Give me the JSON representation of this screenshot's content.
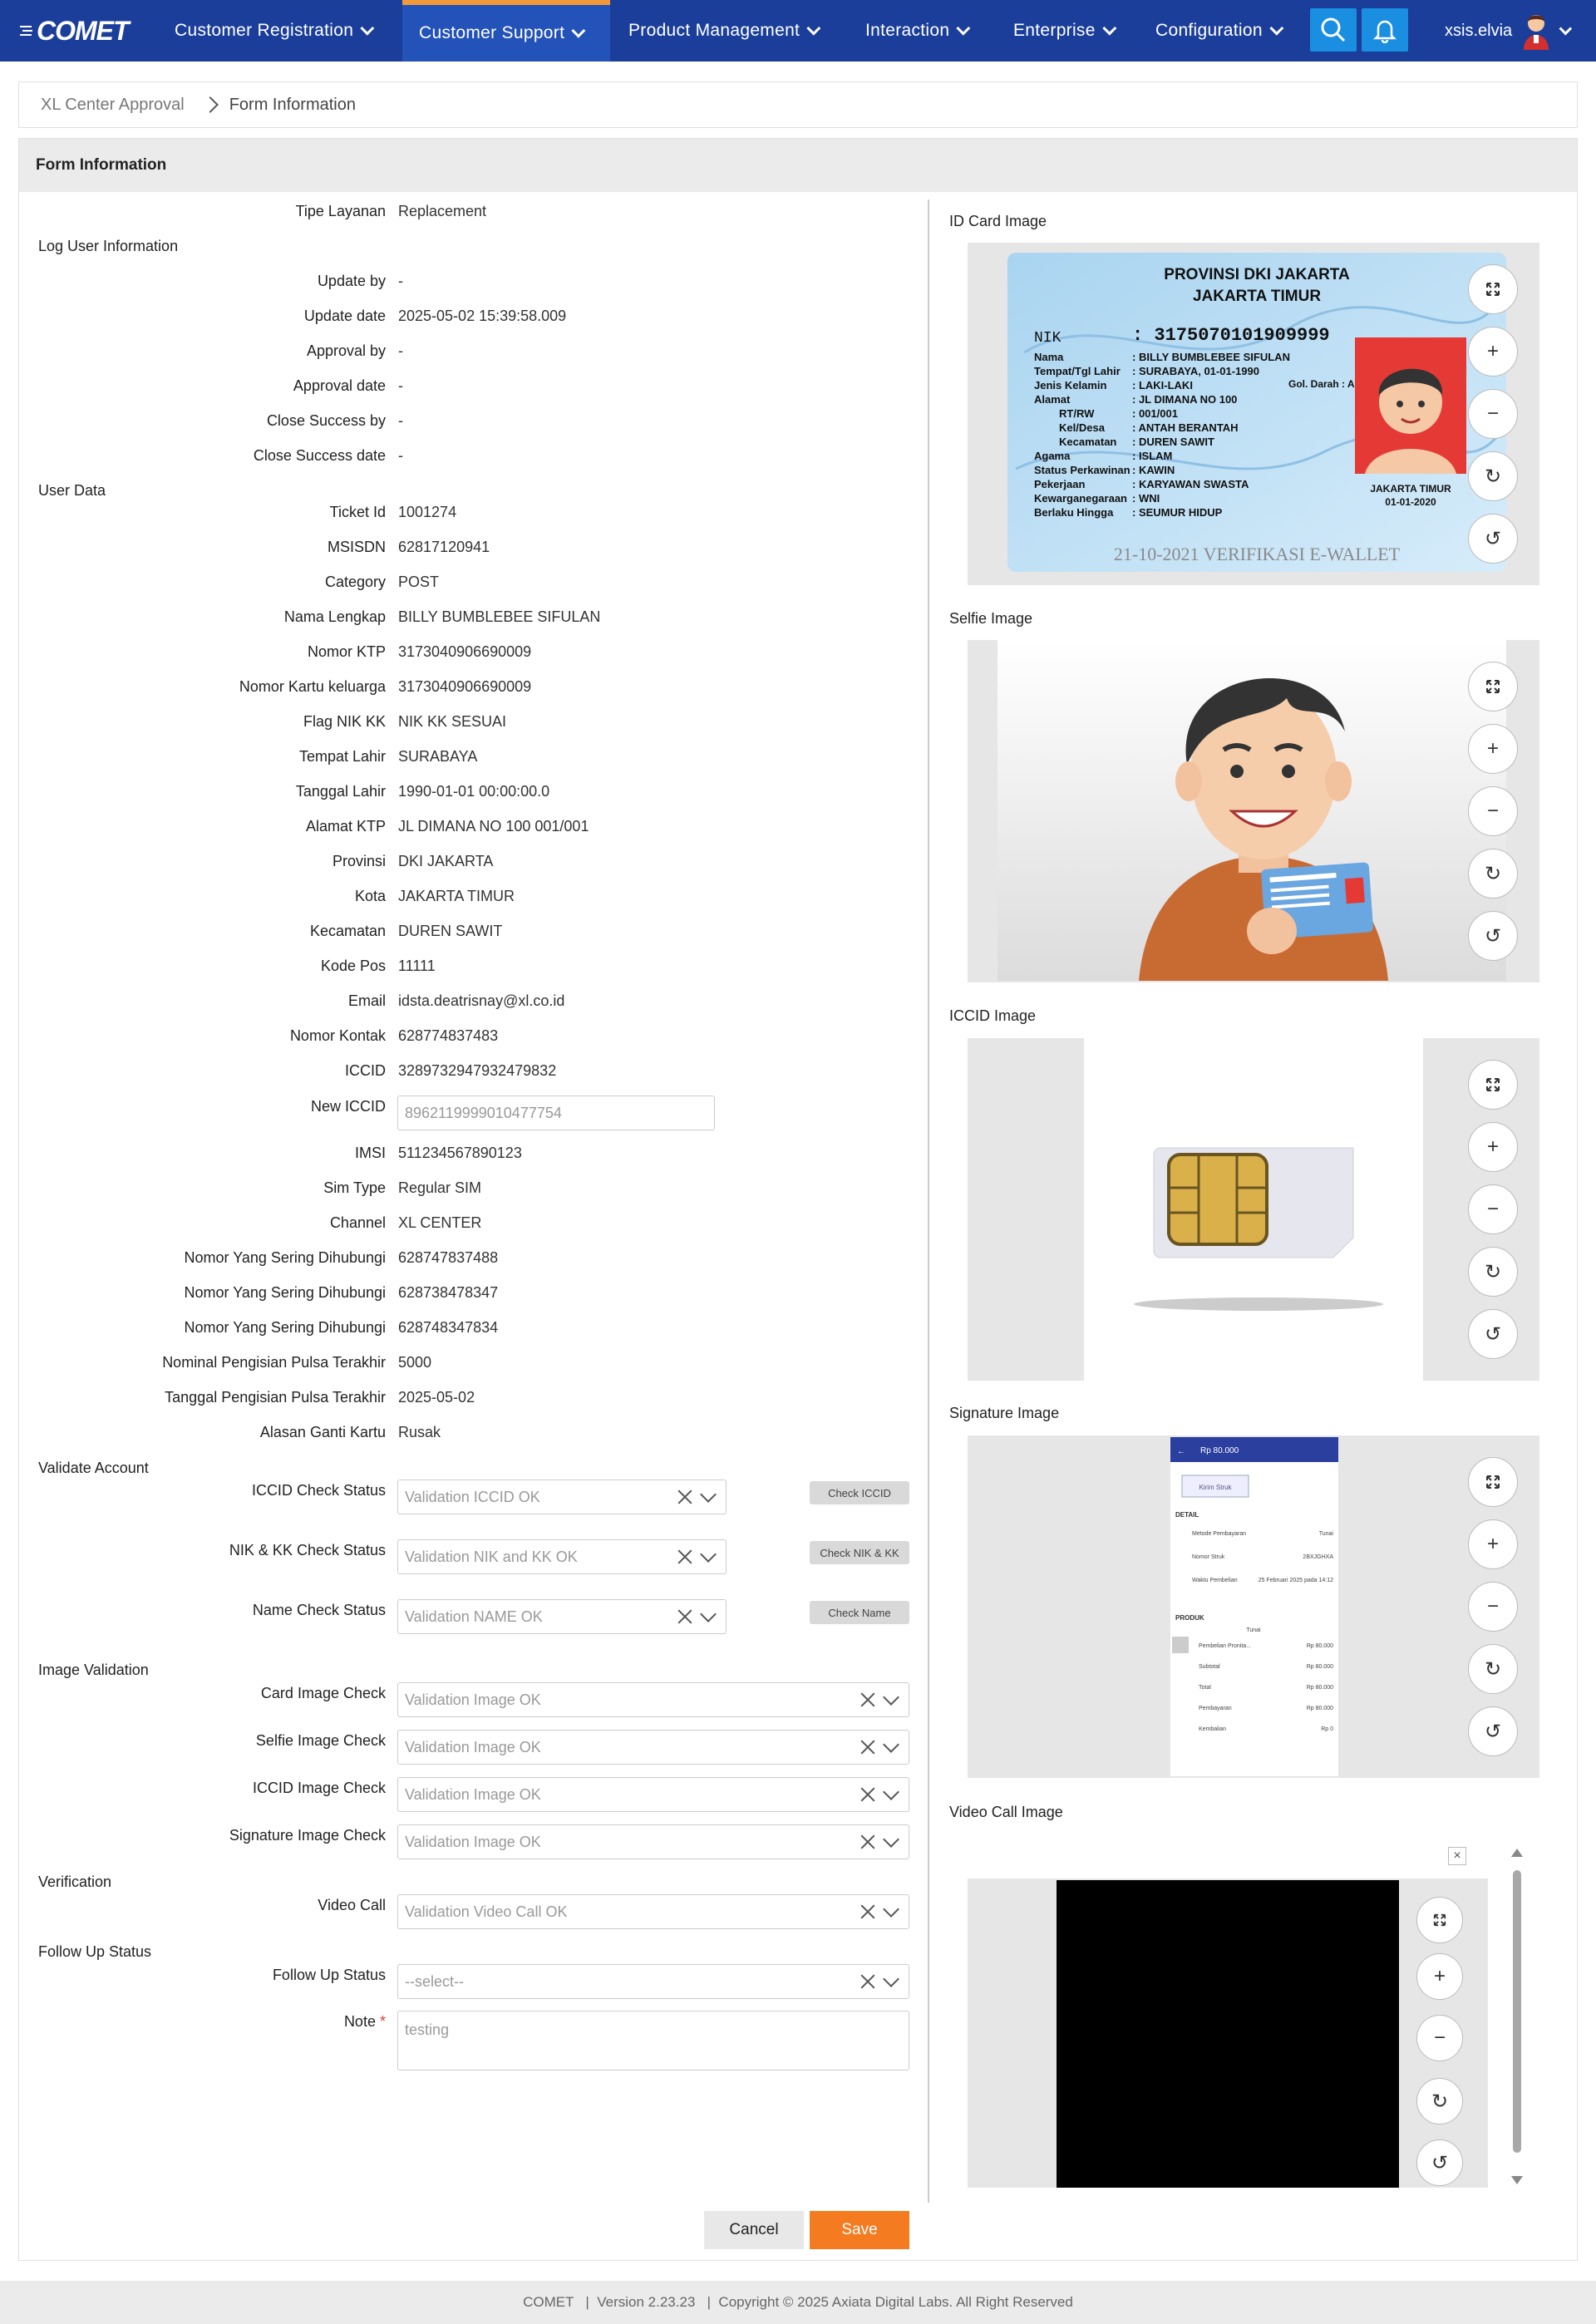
{
  "nav": {
    "logo": "COMET",
    "items": [
      "Customer Registration",
      "Customer Support",
      "Product Management",
      "Interaction",
      "Enterprise",
      "Configuration"
    ],
    "active": "Customer Support",
    "user": "xsis.elvia",
    "accent_color": "#1a3e9a",
    "active_indicator_color": "#f29a3a"
  },
  "breadcrumb": [
    "XL Center Approval",
    "Form Information"
  ],
  "form": {
    "title": "Form Information",
    "tipe_layanan_label": "Tipe Layanan",
    "tipe_layanan_value": "Replacement",
    "sections": {
      "log": "Log User Information",
      "user": "User Data",
      "validate": "Validate Account",
      "image_validation": "Image Validation",
      "verification": "Verification",
      "follow_up": "Follow Up Status"
    },
    "log_fields": [
      {
        "label": "Update by",
        "value": "-"
      },
      {
        "label": "Update date",
        "value": "2025-05-02 15:39:58.009"
      },
      {
        "label": "Approval by",
        "value": "-"
      },
      {
        "label": "Approval date",
        "value": "-"
      },
      {
        "label": "Close Success by",
        "value": "-"
      },
      {
        "label": "Close Success date",
        "value": "-"
      }
    ],
    "user_fields": [
      {
        "label": "Ticket Id",
        "value": "1001274"
      },
      {
        "label": "MSISDN",
        "value": "62817120941"
      },
      {
        "label": "Category",
        "value": "POST"
      },
      {
        "label": "Nama Lengkap",
        "value": "BILLY BUMBLEBEE SIFULAN"
      },
      {
        "label": "Nomor KTP",
        "value": "3173040906690009"
      },
      {
        "label": "Nomor Kartu keluarga",
        "value": "3173040906690009"
      },
      {
        "label": "Flag NIK KK",
        "value": "NIK KK SESUAI"
      },
      {
        "label": "Tempat Lahir",
        "value": "SURABAYA"
      },
      {
        "label": "Tanggal Lahir",
        "value": "1990-01-01 00:00:00.0"
      },
      {
        "label": "Alamat KTP",
        "value": "JL DIMANA NO 100 001/001"
      },
      {
        "label": "Provinsi",
        "value": "DKI JAKARTA"
      },
      {
        "label": "Kota",
        "value": "JAKARTA TIMUR"
      },
      {
        "label": "Kecamatan",
        "value": "DUREN SAWIT"
      },
      {
        "label": "Kode Pos",
        "value": "11111"
      },
      {
        "label": "Email",
        "value": "idsta.deatrisnay@xl.co.id"
      },
      {
        "label": "Nomor Kontak",
        "value": "628774837483"
      },
      {
        "label": "ICCID",
        "value": "3289732947932479832"
      }
    ],
    "new_iccid_label": "New ICCID",
    "new_iccid_value": "8962119999010477754",
    "user_fields2": [
      {
        "label": "IMSI",
        "value": "511234567890123"
      },
      {
        "label": "Sim Type",
        "value": "Regular SIM"
      },
      {
        "label": "Channel",
        "value": "XL CENTER"
      },
      {
        "label": "Nomor Yang Sering Dihubungi",
        "value": "628747837488"
      },
      {
        "label": "Nomor Yang Sering Dihubungi",
        "value": "628738478347"
      },
      {
        "label": "Nomor Yang Sering Dihubungi",
        "value": "628748347834"
      },
      {
        "label": "Nominal Pengisian Pulsa Terakhir",
        "value": "5000"
      },
      {
        "label": "Tanggal Pengisian Pulsa Terakhir",
        "value": "2025-05-02"
      },
      {
        "label": "Alasan Ganti Kartu",
        "value": "Rusak"
      }
    ],
    "validate_fields": [
      {
        "label": "ICCID Check Status",
        "value": "Validation ICCID OK",
        "button": "Check ICCID"
      },
      {
        "label": "NIK & KK Check Status",
        "value": "Validation NIK and KK OK",
        "button": "Check NIK & KK"
      },
      {
        "label": "Name Check Status",
        "value": "Validation NAME OK",
        "button": "Check Name"
      }
    ],
    "image_fields": [
      {
        "label": "Card Image Check",
        "value": "Validation Image OK"
      },
      {
        "label": "Selfie Image Check",
        "value": "Validation Image OK"
      },
      {
        "label": "ICCID Image Check",
        "value": "Validation Image OK"
      },
      {
        "label": "Signature Image Check",
        "value": "Validation Image OK"
      }
    ],
    "video_call_label": "Video Call",
    "video_call_value": "Validation Video Call OK",
    "follow_up_label": "Follow Up Status",
    "follow_up_value": "--select--",
    "note_label": "Note",
    "note_required": "*",
    "note_value": "testing",
    "cancel": "Cancel",
    "save": "Save",
    "save_color": "#f47b20"
  },
  "images": {
    "id_card": "ID Card Image",
    "selfie": "Selfie Image",
    "iccid": "ICCID Image",
    "signature": "Signature Image",
    "video_call": "Video Call Image",
    "ktp": {
      "province": "PROVINSI DKI JAKARTA",
      "city": "JAKARTA TIMUR",
      "nik_label": "NIK",
      "nik": ": 3175070101909999",
      "rows": [
        [
          "Nama",
          ": BILLY BUMBLEBEE SIFULAN"
        ],
        [
          "Tempat/Tgl Lahir",
          ": SURABAYA, 01-01-1990"
        ],
        [
          "Jenis Kelamin",
          ": LAKI-LAKI"
        ],
        [
          "Alamat",
          ": JL DIMANA NO 100"
        ],
        [
          "RT/RW",
          ": 001/001"
        ],
        [
          "Kel/Desa",
          ": ANTAH BERANTAH"
        ],
        [
          "Kecamatan",
          ": DUREN SAWIT"
        ],
        [
          "Agama",
          ": ISLAM"
        ],
        [
          "Status Perkawinan",
          ": KAWIN"
        ],
        [
          "Pekerjaan",
          ": KARYAWAN SWASTA"
        ],
        [
          "Kewarganegaraan",
          ": WNI"
        ],
        [
          "Berlaku Hingga",
          ": SEUMUR HIDUP"
        ]
      ],
      "gol_darah": "Gol. Darah : AB",
      "photo_city": "JAKARTA TIMUR",
      "photo_date": "01-01-2020",
      "stamp": "21-10-2021 VERIFIKASI E-WALLET"
    },
    "receipt": {
      "amount": "Rp 80.000",
      "button": "Kirim Struk",
      "detail": "DETAIL",
      "rows": [
        [
          "Metode Pembayaran",
          "Tunai"
        ],
        [
          "Nomor Struk",
          "2BXJGHXA"
        ],
        [
          "Waktu Pembelian",
          "25 Februari 2025 pada 14:12"
        ]
      ],
      "produk": "PRODUK",
      "tunai": "Tunai",
      "items": [
        [
          "Pembelian Pronita...",
          "Rp 80.000"
        ],
        [
          "Subtotal",
          "Rp 80.000"
        ],
        [
          "Total",
          "Rp 80.000"
        ],
        [
          "Pembayaran",
          "Rp 80.000"
        ],
        [
          "Kembalian",
          "Rp 0"
        ]
      ]
    }
  },
  "footer": "COMET   |  Version 2.23.23   |  Copyright © 2025 Axiata Digital Labs. All Right Reserved"
}
